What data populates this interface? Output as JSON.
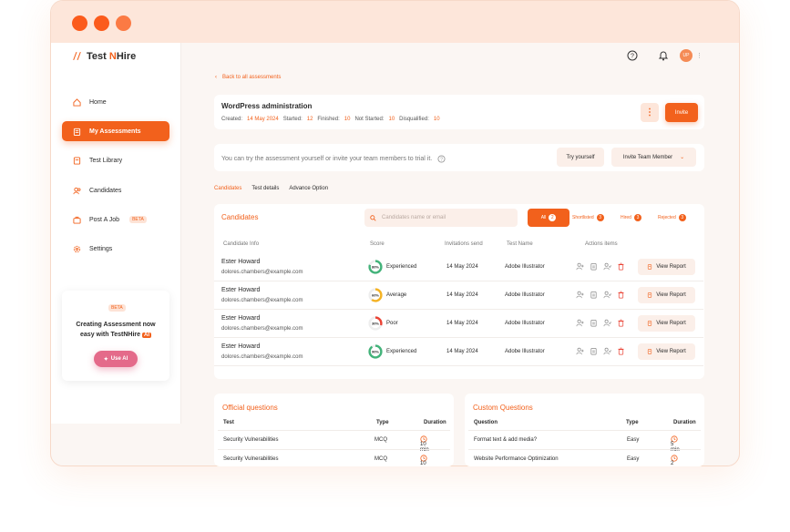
{
  "window": {
    "dots": [
      "#fb5b1c",
      "#fb5b1c",
      "#fb7a44"
    ]
  },
  "brand": {
    "part1": "Test ",
    "part2": "N",
    "part3": "Hire"
  },
  "sidebar": {
    "items": [
      {
        "label": "Home",
        "icon": "home-icon"
      },
      {
        "label": "My Assessments",
        "icon": "clipboard-icon"
      },
      {
        "label": "Test Library",
        "icon": "book-icon"
      },
      {
        "label": "Candidates",
        "icon": "users-icon"
      },
      {
        "label": "Post A Job",
        "icon": "briefcase-icon",
        "badge": "BETA"
      },
      {
        "label": "Settings",
        "icon": "gear-icon"
      }
    ],
    "promo": {
      "badge": "BETA",
      "line1": "Creating Assessment now",
      "line2": "easy with TestNHire",
      "ai": "AI",
      "button": "Use AI"
    }
  },
  "header": {
    "avatar": "UP"
  },
  "back_link": "Back to all assessments",
  "assessment": {
    "title": "WordPress administration",
    "created_label": "Created:",
    "created_value": "14 May 2024",
    "started_label": "Started:",
    "started_value": "12",
    "finished_label": "Finished:",
    "finished_value": "10",
    "not_started_label": "Not Started:",
    "not_started_value": "10",
    "disqualified_label": "Disqualified:",
    "disqualified_value": "10",
    "more_label": "⋮",
    "invite_label": "Invite"
  },
  "trial": {
    "text": "You can try the assessment yourself or invite your team members to trial it.",
    "try_label": "Try yourself",
    "team_label": "Invite Team Member"
  },
  "tabs": [
    "Candidates",
    "Test details",
    "Advance Option"
  ],
  "candidates": {
    "title": "Candidates",
    "search_placeholder": "Candidates name or email",
    "filters": [
      {
        "label": "All",
        "count": "2"
      },
      {
        "label": "Shortlisted",
        "count": "3"
      },
      {
        "label": "Hired",
        "count": "3"
      },
      {
        "label": "Rejected",
        "count": "3"
      }
    ],
    "columns": [
      "Candidate Info",
      "Score",
      "Invitations send",
      "Test Name",
      "Actions items"
    ],
    "rows": [
      {
        "name": "Ester Howard",
        "email": "dolores.chambers@example.com",
        "score": "80%",
        "score_fraction": 0.8,
        "level": "Experienced",
        "ring_color": "#43b37a",
        "date": "14 May 2024",
        "test": "Adobe Illustrator",
        "report": "View Report"
      },
      {
        "name": "Ester Howard",
        "email": "dolores.chambers@example.com",
        "score": "60%",
        "score_fraction": 0.6,
        "level": "Average",
        "ring_color": "#f5b324",
        "date": "14 May 2024",
        "test": "Adobe Illustrator",
        "report": "View Report"
      },
      {
        "name": "Ester Howard",
        "email": "dolores.chambers@example.com",
        "score": "30%",
        "score_fraction": 0.3,
        "level": "Poor",
        "ring_color": "#ea4335",
        "date": "14 May 2024",
        "test": "Adobe Illustrator",
        "report": "View Report"
      },
      {
        "name": "Ester Howard",
        "email": "dolores.chambers@example.com",
        "score": "90%",
        "score_fraction": 0.9,
        "level": "Experienced",
        "ring_color": "#43b37a",
        "date": "14 May 2024",
        "test": "Adobe Illustrator",
        "report": "View Report"
      }
    ]
  },
  "official_questions": {
    "title": "Official questions",
    "columns": [
      "Test",
      "Type",
      "Duration"
    ],
    "rows": [
      {
        "test": "Security Vulnerabilities",
        "type": "MCQ",
        "duration": "10 min"
      },
      {
        "test": "Security Vulnerabilities",
        "type": "MCQ",
        "duration": "10 min"
      }
    ]
  },
  "custom_questions": {
    "title": "Custom Questions",
    "columns": [
      "Question",
      "Type",
      "Duration"
    ],
    "rows": [
      {
        "test": "Format text & add media?",
        "type": "Easy",
        "duration": "5 min"
      },
      {
        "test": "Website Performance Optimization",
        "type": "Easy",
        "duration": "2 min"
      }
    ]
  },
  "colors": {
    "accent": "#f2611c",
    "accent_soft": "#fde6da"
  }
}
